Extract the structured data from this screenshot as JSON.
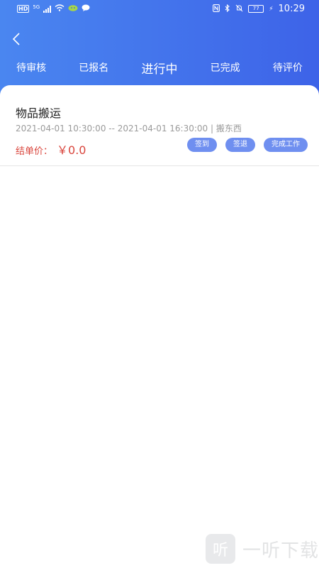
{
  "status_bar": {
    "hd": "HD",
    "network": "5G",
    "time": "10:29",
    "battery": "77"
  },
  "tabs": [
    {
      "label": "待审核",
      "active": false
    },
    {
      "label": "已报名",
      "active": false
    },
    {
      "label": "进行中",
      "active": true
    },
    {
      "label": "已完成",
      "active": false
    },
    {
      "label": "待评价",
      "active": false
    }
  ],
  "order": {
    "title": "物品搬运",
    "meta": "2021-04-01 10:30:00 -- 2021-04-01 16:30:00 | 搬东西",
    "price_label": "结单价：",
    "price_value": "￥0.0",
    "actions": [
      "签到",
      "签退",
      "完成工作"
    ]
  },
  "watermark": {
    "logo_char": "听",
    "text": "一听下载"
  },
  "colors": {
    "header_start": "#4a86f0",
    "header_end": "#3d63e8",
    "price": "#d9443b",
    "button": "#6f8ff0"
  }
}
